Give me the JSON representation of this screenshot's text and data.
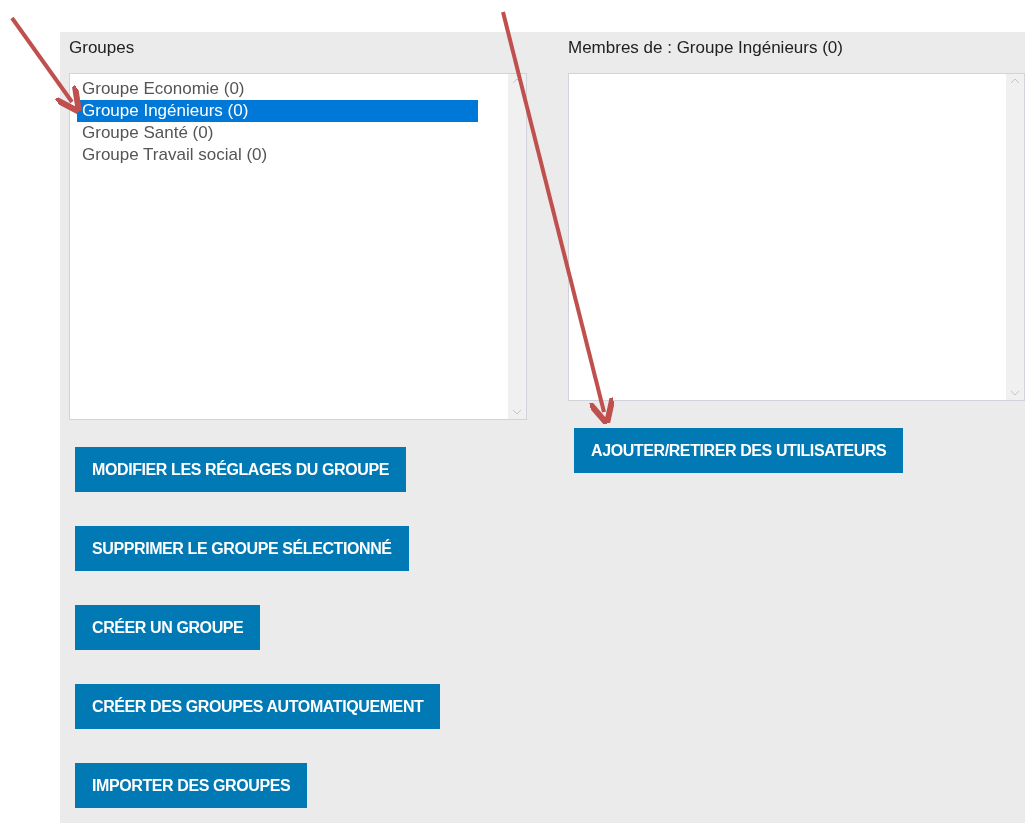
{
  "groups_panel": {
    "label": "Groupes",
    "items": [
      {
        "label": "Groupe Economie (0)",
        "selected": false
      },
      {
        "label": "Groupe Ingénieurs (0)",
        "selected": true
      },
      {
        "label": "Groupe Santé (0)",
        "selected": false
      },
      {
        "label": "Groupe Travail social (0)",
        "selected": false
      }
    ],
    "buttons": [
      "MODIFIER LES RÉGLAGES DU GROUPE",
      "SUPPRIMER LE GROUPE SÉLECTIONNÉ",
      "CRÉER UN GROUPE",
      "CRÉER DES GROUPES AUTOMATIQUEMENT",
      "IMPORTER DES GROUPES"
    ]
  },
  "members_panel": {
    "label": "Membres de : Groupe Ingénieurs (0)",
    "buttons": [
      "AJOUTER/RETIRER DES UTILISATEURS"
    ]
  }
}
